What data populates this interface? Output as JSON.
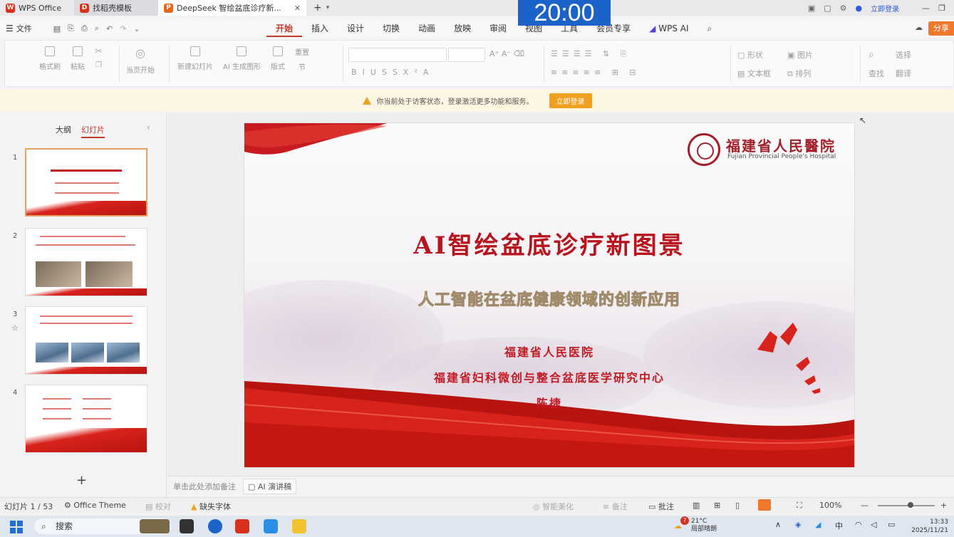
{
  "tabs": [
    {
      "label": "WPS Office"
    },
    {
      "label": "找稻壳模板"
    },
    {
      "label": "DeepSeek 智绘盆底诊疗新..."
    }
  ],
  "titlebar": {
    "login_label": "立即登录"
  },
  "overlay_clock": "20:00",
  "menubar": {
    "file_label": "文件",
    "items": [
      "开始",
      "插入",
      "设计",
      "切换",
      "动画",
      "放映",
      "审阅",
      "视图",
      "工具",
      "会员专享"
    ],
    "active": "开始",
    "wps_ai": "WPS AI",
    "share_label": "分享"
  },
  "ribbon": {
    "format_painter": "格式刷",
    "paste": "粘贴",
    "from_start": "当页开始",
    "new_slide": "新建幻灯片",
    "ai_generate": "AI 生成图形",
    "layout": "版式",
    "reset": "重置",
    "section": "节",
    "shape": "形状",
    "picture": "图片",
    "textbox": "文本框",
    "arrange": "排列",
    "find": "查找",
    "select": "选择",
    "replace": "翻译"
  },
  "notice": {
    "text": "你当前处于访客状态，登录激活更多功能和服务。",
    "button": "立即登录"
  },
  "leftpanel": {
    "tab_outline": "大纲",
    "tab_slides": "幻灯片",
    "slide_numbers": [
      "1",
      "2",
      "3",
      "4"
    ],
    "add": "+"
  },
  "slide": {
    "title": "AI智绘盆底诊疗新图景",
    "subtitle": "人工智能在盆底健康领域的创新应用",
    "line1": "福建省人民医院",
    "line2": "福建省妇科微创与整合盆底医学研究中心",
    "line3": "陈捷",
    "logo_cn": "福建省人民醫院",
    "logo_en": "Fujian Provincial People's Hospital"
  },
  "notes": {
    "placeholder": "单击此处添加备注",
    "ai_notes": "AI 演讲稿"
  },
  "statusbar": {
    "slide_count": "幻灯片 1 / 53",
    "theme": "Office Theme",
    "proofread": "校对",
    "missing_font": "缺失字体",
    "smart_beautify": "智能美化",
    "notes_toggle": "备注",
    "comments": "批注",
    "zoom": "100%"
  },
  "taskbar": {
    "search": "搜索",
    "weather_temp": "21°C",
    "weather_desc": "局部晴朗",
    "weather_badge": "7",
    "time": "13:33",
    "date": "2025/11/21",
    "ime": "中"
  },
  "colors": {
    "accent": "#c33a28",
    "slide_red": "#b8141e",
    "clock_bg": "#1c63c9",
    "notice_bg": "#fdf6e3"
  }
}
